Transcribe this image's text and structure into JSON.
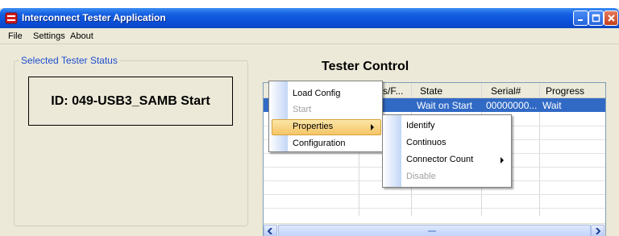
{
  "window": {
    "title": "Interconnect Tester Application"
  },
  "menubar": {
    "items": [
      "File",
      "Settings",
      "About"
    ]
  },
  "status_panel": {
    "group_label": "Selected Tester Status",
    "status_text": "ID: 049-USB3_SAMB Start"
  },
  "tester_control": {
    "title": "Tester Control",
    "columns": [
      "s/F...",
      "State",
      "Serial#",
      "Progress"
    ],
    "selected_row": {
      "state": "Wait on Start",
      "serial": "00000000...",
      "progress": "Wait"
    }
  },
  "context_menu": {
    "items": [
      {
        "label": "Load Config",
        "enabled": true
      },
      {
        "label": "Start",
        "enabled": false
      },
      {
        "label": "Properties",
        "enabled": true,
        "highlighted": true,
        "has_submenu": true
      },
      {
        "label": "Configuration",
        "enabled": true
      }
    ]
  },
  "submenu": {
    "items": [
      {
        "label": "Identify",
        "enabled": true
      },
      {
        "label": "Continuos",
        "enabled": true
      },
      {
        "label": "Connector Count",
        "enabled": true,
        "has_submenu": true
      },
      {
        "label": "Disable",
        "enabled": false
      }
    ]
  },
  "colors": {
    "titlebar": "#0a4fd6",
    "group_label": "#1f4fcf",
    "selection": "#316ac5",
    "menu_highlight": "#f6c566"
  },
  "icons": [
    "app-icon",
    "minimize-icon",
    "maximize-icon",
    "close-icon",
    "chevron-right-icon",
    "scroll-left-icon",
    "scroll-right-icon"
  ]
}
